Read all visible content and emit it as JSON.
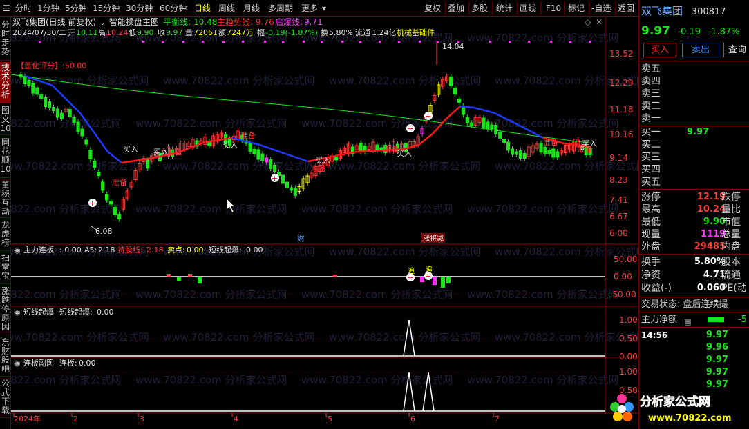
{
  "toolbar": {
    "items": [
      "分时",
      "1分钟",
      "5分钟",
      "15分钟",
      "30分钟",
      "60分钟",
      "日线",
      "周线",
      "月线",
      "多周期",
      "更多"
    ],
    "active": "日线",
    "right_items": [
      "复权",
      "叠加",
      "多股",
      "统计",
      "画线",
      "F10",
      "标记",
      "-自选",
      "返回"
    ]
  },
  "left_tabs": [
    "分时走势",
    "技术分析",
    "图文10",
    "同花顺10",
    "董秘互动",
    "龙虎榜",
    "扫雷宝",
    "涨跌停原因",
    "东财股吧",
    "公式下载"
  ],
  "left_active": "技术分析",
  "main_header": {
    "stock": "双飞集团(日线 前复权)",
    "formula": "智能操盘主图",
    "indicators": [
      {
        "label": "平衡线:",
        "value": "10.48",
        "color": "#19e619"
      },
      {
        "label": "主趋势线:",
        "value": "9.76",
        "color": "#ff2a2a"
      },
      {
        "label": "启爆线:",
        "value": "9.71",
        "color": "#ff44ff"
      }
    ],
    "info_line": {
      "date": "2024/07/30/二",
      "open_label": "开",
      "open": "10.11",
      "high_label": "高",
      "high": "10.24",
      "low_label": "低",
      "low": "9.90",
      "close_label": "收",
      "close": "9.97",
      "vol_label": "量",
      "vol": "72061",
      "amt_label": "额",
      "amt": "7247万",
      "chg_label": "幅",
      "chg": "-0.19(-1.87%)",
      "turn_label": "换",
      "turn": "5.80%",
      "float_label": "流通",
      "float": "1.24亿",
      "sector": "机械基础件"
    },
    "score": "【量化评分】:50.00"
  },
  "price_axis": [
    "13.52",
    "12.29",
    "11.18",
    "10.16",
    "9.14",
    "8.23",
    "7.41",
    "6.67",
    "6.00"
  ],
  "annotations": {
    "high_price": "14.04",
    "low_price": "6.08",
    "buy": "买入",
    "ready": "准备",
    "cai": "财",
    "zhangchengjian": "涨将减"
  },
  "sub1": {
    "title": "主力连板",
    "label1": ": 0.00",
    "a5_label": "A5:",
    "a5": "2.18",
    "hold_label": "持股线:",
    "hold": "2.18",
    "sell_label": "卖点:",
    "sell": "0.00",
    "short_label": "短线起爆:",
    "short": "0.00",
    "axis": [
      "50.00",
      "0.00",
      "-50.00"
    ],
    "marker": "追"
  },
  "sub2": {
    "title": "短线起爆",
    "label": "短线起爆:",
    "value": "0.00",
    "axis": [
      "1.00",
      "0.50",
      "0.00"
    ]
  },
  "sub3": {
    "title": "连板副图",
    "label": "连板:",
    "value": "0.00",
    "axis": [
      "1.00",
      "0.50"
    ]
  },
  "date_axis": [
    "2024年",
    "2",
    "3",
    "4",
    "5",
    "6",
    "7"
  ],
  "watermark": "www.70822.com 分析家公式网",
  "quote": {
    "name": "双飞集团",
    "code": "300817",
    "price": "9.97",
    "change": "-0.19",
    "pct": "-1.87%",
    "buy_btn": "买入",
    "sell_btn": "卖出",
    "query_btn": "查询",
    "sell_levels": [
      "卖五",
      "卖四",
      "卖三",
      "卖二",
      "卖一"
    ],
    "buy_levels": [
      "买一",
      "买二",
      "买三",
      "买四",
      "买五"
    ],
    "buy1_price": "9.97",
    "stats": [
      {
        "label": "涨停",
        "value": "12.19",
        "color": "red",
        "label2": "跌停"
      },
      {
        "label": "最高",
        "value": "10.24",
        "color": "red",
        "label2": "量比"
      },
      {
        "label": "最低",
        "value": "9.90",
        "color": "green",
        "label2": "市值"
      },
      {
        "label": "现量",
        "value": "1119",
        "color": "magenta",
        "label2": "总量"
      },
      {
        "label": "外盘",
        "value": "29485",
        "color": "red",
        "label2": "内盘"
      }
    ],
    "stats2": [
      {
        "label": "换手",
        "value": "5.80%",
        "label2": "股本"
      },
      {
        "label": "净资",
        "value": "4.71",
        "label2": "流通"
      },
      {
        "label": "收益(-)",
        "value": "0.060",
        "label2": "PE(动"
      }
    ],
    "trade_status": "交易状态: 盘后连续撮",
    "net_label": "主力净额",
    "net_value": "-5",
    "tick_time": "14:56",
    "ticks": [
      "9.97",
      "9.96",
      "9.97",
      "9.97",
      "9.97"
    ]
  },
  "logo": {
    "title": "分析家公式网",
    "url": "www.70822.com"
  }
}
